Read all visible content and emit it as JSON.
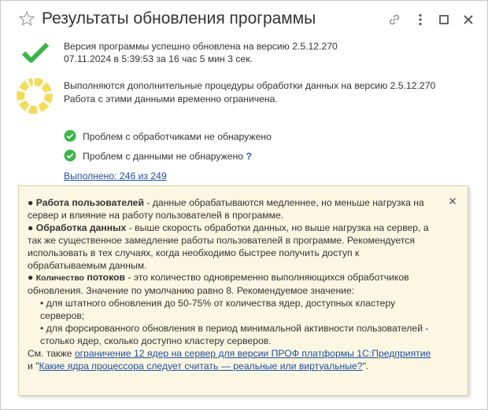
{
  "title": "Результаты обновления программы",
  "status": {
    "line1": "Версия программы успешно обновлена на версию 2.5.12.270",
    "line2": "07.11.2024 в 5:39:53 за 16 час 5 мин 3 сек."
  },
  "processing": {
    "line1": "Выполняются дополнительные процедуры обработки данных на версию 2.5.12.270",
    "line2": "Работа с этими данными временно ограничена."
  },
  "checks": {
    "handlers": "Проблем с обработчиками не обнаружено",
    "data": "Проблем с данными не обнаружено",
    "help": "?"
  },
  "progress": {
    "link": "Выполнено: 246 из 249",
    "done": 246,
    "total": 249
  },
  "tooltip": {
    "bullet": "●",
    "p1_title": "Работа пользователей",
    "p1_text": " - данные обрабатываются медленнее, но меньше нагрузка на сервер и влияние на работу пользователей в программе.",
    "p2_title": "Обработка данных",
    "p2_text": " - выше скорость обработки данных, но выше нагрузка на сервер, а так же существенное замедление работы пользователей в программе. Рекомендуется использовать в тех случаях, когда необходимо быстрее получить доступ к обрабатываемым данным.",
    "p3_title_small": "Количество",
    "p3_title_big": "потоков",
    "p3_text": " - это количество одновременно выполняющихся обработчиков обновления. Значение по умолчанию равно 8. Рекомендуемое значение:",
    "sub1": "• для штатного обновления до 50-75% от количества ядер, доступных кластеру серверов;",
    "sub2": "• для форсированного обновления в период минимальной активности пользователей - столько ядер, сколько доступно кластеру серверов.",
    "see_also": "См. также ",
    "link1": "ограничение 12 ядер на  сервер для версии ПРОФ платформы 1С:Предприятие",
    "and": " и \"",
    "link2": "Какие  ядра процессора следует считать — реальные или виртуальные?",
    "end": "\"."
  },
  "colors": {
    "green": "#3cb44a",
    "spinner": "#f3dd58",
    "tooltip_bg": "#fbf7e3",
    "link": "#1f4fa0"
  }
}
